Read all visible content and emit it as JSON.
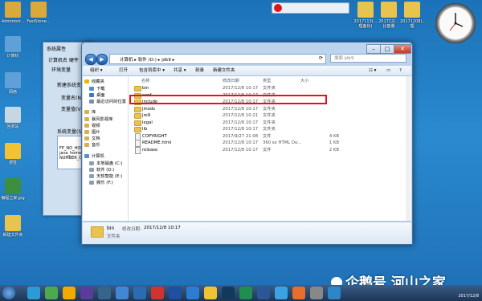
{
  "desktop": {
    "icons": [
      {
        "label": "Administr...",
        "color": "#d9a93a"
      },
      {
        "label": "FastStone...",
        "color": "#d9a93a"
      },
      {
        "label": "计算机",
        "color": "#5fa0d8"
      },
      {
        "label": "网络",
        "color": "#5fa0d8"
      },
      {
        "label": "回收站",
        "color": "#c8d5e3"
      },
      {
        "label": "便签",
        "color": "#f1c232"
      },
      {
        "label": "编程之家.jpg",
        "color": "#3c8f3c"
      },
      {
        "label": "新建文件夹",
        "color": "#e8c44f"
      },
      {
        "label": "2017113(...\n理备份)",
        "color": "#e8c44f"
      },
      {
        "label": "201712(...\n比能量",
        "color": "#e8c44f"
      },
      {
        "label": "20171208(...\n理",
        "color": "#e8c44f"
      }
    ],
    "colors": {
      "accent": "#e0141e",
      "folder": "#e8c44f"
    }
  },
  "bg_window": {
    "title": "系统属性",
    "tab1": "计算机名",
    "tab2": "硬件",
    "env_label": "环境变量",
    "newvar_label": "新建系统变",
    "var_name": "变量名(N)",
    "var_value": "变量值(V)",
    "sysvar_label": "系统变量(S)",
    "sys_rows": [
      "FP_NO_HOST",
      "java_home",
      "NUMBER_OF_P"
    ]
  },
  "explorer": {
    "breadcrumb": [
      "计算机",
      "软件 (D:)",
      "jdk9"
    ],
    "search_placeholder": "搜索 jdk9",
    "toolbar": {
      "organize": "组织 ▾",
      "open": "打开",
      "include": "包含到库中 ▾",
      "share": "共享 ▾",
      "burn": "刻录",
      "new_folder": "新建文件夹"
    },
    "nav": [
      {
        "label": "收藏夹",
        "type": "star"
      },
      {
        "label": "下载",
        "type": "folder"
      },
      {
        "label": "桌面",
        "type": "desktop"
      },
      {
        "label": "最近访问的位置",
        "type": "recent"
      },
      {
        "label": "库",
        "type": "lib"
      },
      {
        "label": "暴风影视库",
        "type": "lib"
      },
      {
        "label": "视频",
        "type": "lib"
      },
      {
        "label": "图片",
        "type": "lib"
      },
      {
        "label": "文档",
        "type": "lib"
      },
      {
        "label": "音乐",
        "type": "lib"
      },
      {
        "label": "计算机",
        "type": "pc"
      },
      {
        "label": "本地磁盘 (C:)",
        "type": "drive"
      },
      {
        "label": "软件 (D:)",
        "type": "drive"
      },
      {
        "label": "天软智能 (E:)",
        "type": "drive"
      },
      {
        "label": "娱乐 (F:)",
        "type": "drive"
      }
    ],
    "columns": {
      "name": "名称",
      "date": "修改日期",
      "type": "类型",
      "size": "大小"
    },
    "files": [
      {
        "name": "bin",
        "date": "2017/12/8 10:17",
        "type": "文件夹",
        "size": "",
        "kind": "folder"
      },
      {
        "name": "conf",
        "date": "2017/12/8 10:17",
        "type": "文件夹",
        "size": "",
        "kind": "folder"
      },
      {
        "name": "include",
        "date": "2017/12/8 10:17",
        "type": "文件夹",
        "size": "",
        "kind": "folder"
      },
      {
        "name": "jmods",
        "date": "2017/12/8 10:17",
        "type": "文件夹",
        "size": "",
        "kind": "folder"
      },
      {
        "name": "jre9",
        "date": "2017/12/8 10:21",
        "type": "文件夹",
        "size": "",
        "kind": "folder"
      },
      {
        "name": "legal",
        "date": "2017/12/8 10:17",
        "type": "文件夹",
        "size": "",
        "kind": "folder"
      },
      {
        "name": "lib",
        "date": "2017/12/8 10:17",
        "type": "文件夹",
        "size": "",
        "kind": "folder"
      },
      {
        "name": "COPYRIGHT",
        "date": "2017/9/27 21:08",
        "type": "文件",
        "size": "4 KB",
        "kind": "file"
      },
      {
        "name": "README.html",
        "date": "2017/12/8 10:17",
        "type": "360 se HTML Do...",
        "size": "1 KB",
        "kind": "file"
      },
      {
        "name": "release",
        "date": "2017/12/8 10:17",
        "type": "文件",
        "size": "2 KB",
        "kind": "file"
      }
    ],
    "details": {
      "name": "bin",
      "date_label": "修改日期:",
      "date": "2017/12/8 10:17",
      "type": "文件夹"
    }
  },
  "watermark": "企鹅号 河山之家",
  "taskbar": {
    "date": "2017/12/8",
    "items": [
      "#2a9bd6",
      "#4caa4c",
      "#f2a900",
      "#5a3d9a",
      "#36648b",
      "#4287d6",
      "#2b6cb0",
      "#d0342c",
      "#1f4fa0",
      "#2b7cd3",
      "#f1c232",
      "#13385e",
      "#1e8f4e",
      "#2b5797",
      "#3aa3e3",
      "#e66f2d",
      "#888888",
      "#2e85c8"
    ]
  }
}
